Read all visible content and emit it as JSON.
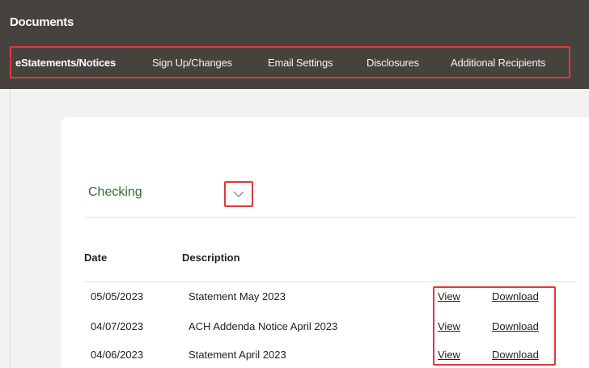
{
  "header": {
    "title": "Documents"
  },
  "nav": {
    "items": [
      {
        "label": "eStatements/Notices",
        "active": true
      },
      {
        "label": "Sign Up/Changes"
      },
      {
        "label": "Email Settings"
      },
      {
        "label": "Disclosures"
      },
      {
        "label": "Additional Recipients"
      }
    ]
  },
  "account_select": {
    "value": "Checking",
    "icon": "chevron-down-icon"
  },
  "table": {
    "columns": [
      "Date",
      "Description"
    ],
    "rows": [
      {
        "date": "05/05/2023",
        "description": "Statement May 2023",
        "view": "View",
        "download": "Download"
      },
      {
        "date": "04/07/2023",
        "description": "ACH Addenda Notice April 2023",
        "view": "View",
        "download": "Download"
      },
      {
        "date": "04/06/2023",
        "description": "Statement April 2023",
        "view": "View",
        "download": "Download"
      }
    ]
  },
  "colors": {
    "header_bg": "#46423e",
    "highlight": "#e0383b",
    "account_text": "#2e6b36"
  }
}
